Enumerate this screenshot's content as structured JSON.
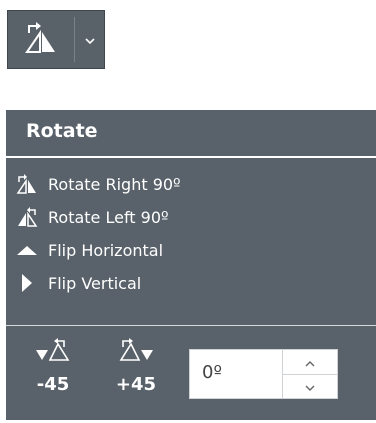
{
  "top_button": {
    "icon": "rotate-right-icon",
    "dropdown_icon": "chevron-down-icon"
  },
  "panel": {
    "title": "Rotate",
    "items": [
      {
        "label": "Rotate Right 90º",
        "icon": "rotate-right-icon"
      },
      {
        "label": "Rotate Left 90º",
        "icon": "rotate-left-icon"
      },
      {
        "label": "Flip Horizontal",
        "icon": "flip-horizontal-icon"
      },
      {
        "label": "Flip Vertical",
        "icon": "flip-vertical-icon"
      }
    ],
    "rotate_minus": {
      "label": "-45",
      "icon": "rotate-left-45-icon"
    },
    "rotate_plus": {
      "label": "+45",
      "icon": "rotate-right-45-icon"
    },
    "angle": {
      "value": "0º"
    }
  },
  "colors": {
    "panel_bg": "#59626a",
    "text": "#ffffff",
    "button_bg": "#5a6269"
  }
}
